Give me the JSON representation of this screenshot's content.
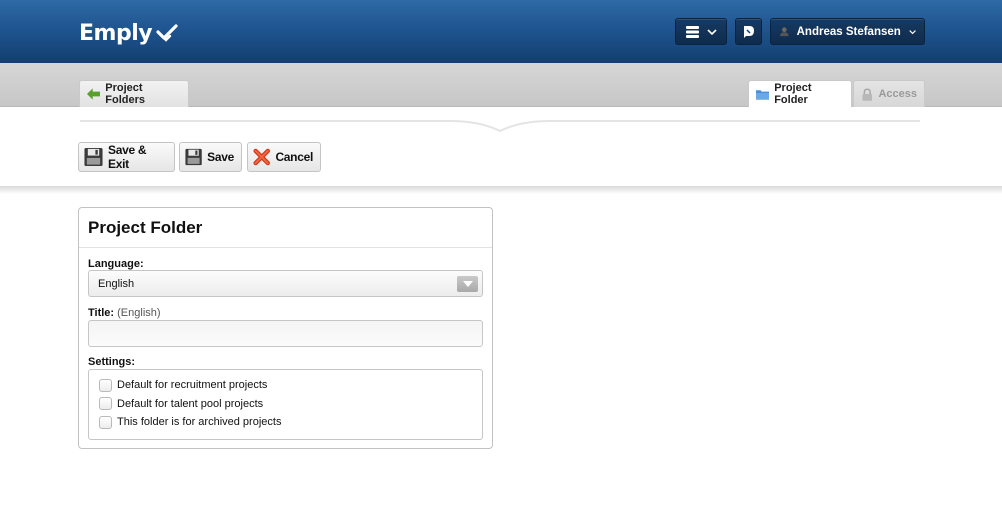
{
  "header": {
    "logo_text": "Emply",
    "user_name": "Andreas Stefansen",
    "brand_color": "#1f5590"
  },
  "tabs": {
    "back_label": "Project Folders",
    "folder_label": "Project Folder",
    "access_label": "Access"
  },
  "toolbar": {
    "save_exit_label": "Save & Exit",
    "save_label": "Save",
    "cancel_label": "Cancel"
  },
  "form": {
    "title": "Project Folder",
    "language_label": "Language:",
    "language_value": "English",
    "title_label": "Title:",
    "title_sub": "(English)",
    "title_value": "",
    "settings_label": "Settings:",
    "settings": [
      {
        "label": "Default for recruitment projects",
        "checked": false
      },
      {
        "label": "Default for talent pool projects",
        "checked": false
      },
      {
        "label": "This folder is for archived projects",
        "checked": false
      }
    ]
  },
  "icons": [
    "logo-mark-icon",
    "list-menu-icon",
    "chevron-down-icon",
    "notification-icon",
    "user-icon",
    "arrow-left-icon",
    "folder-icon",
    "lock-icon",
    "floppy-disk-icon",
    "cancel-x-icon",
    "select-arrow-icon"
  ]
}
